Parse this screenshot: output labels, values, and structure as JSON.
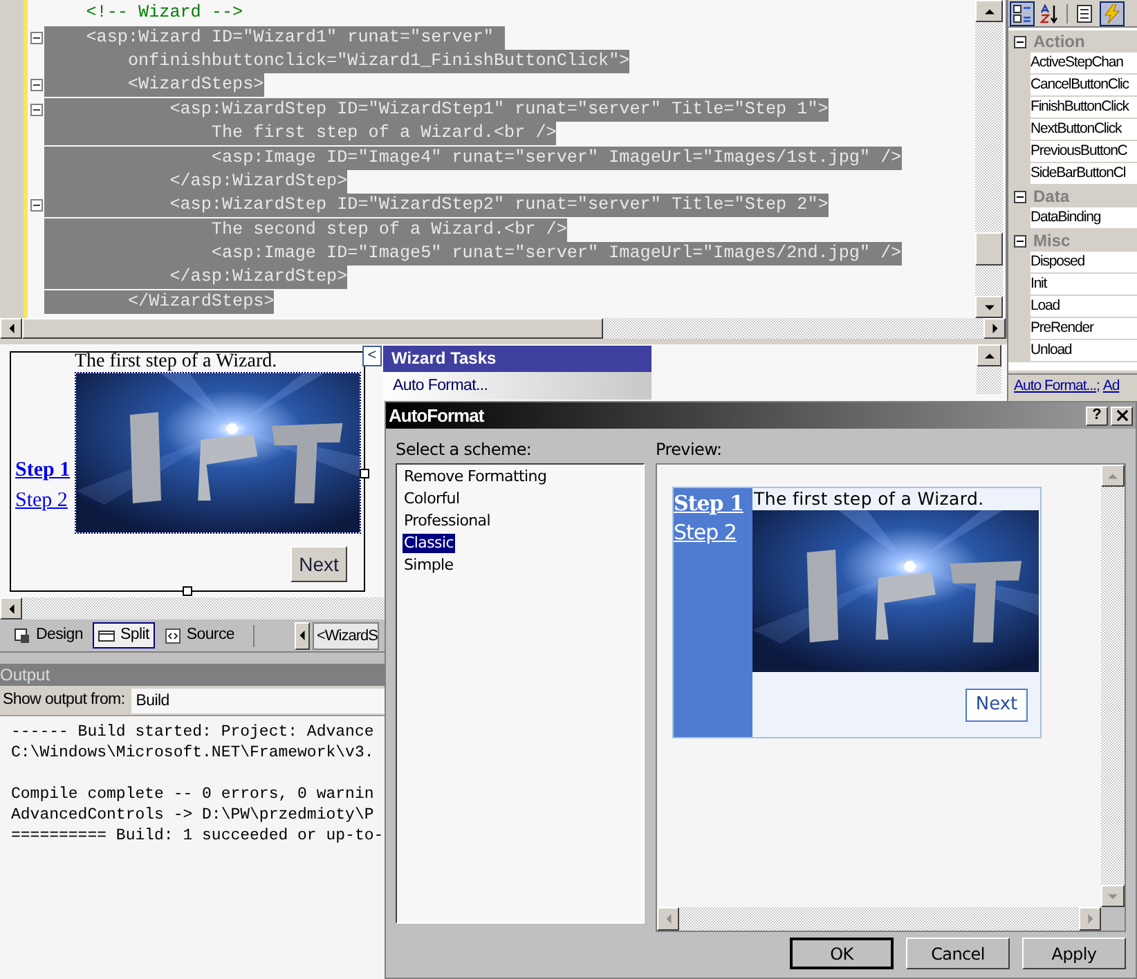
{
  "editor": {
    "lines": [
      {
        "text": "    <!-- Wizard -->",
        "kind": "comment",
        "selected": false,
        "foldable": false
      },
      {
        "text": "    <asp:Wizard ID=\"Wizard1\" runat=\"server\" ",
        "kind": "markup",
        "selected": true,
        "foldable": true
      },
      {
        "text": "        onfinishbuttonclick=\"Wizard1_FinishButtonClick\">",
        "kind": "markup",
        "selected": true,
        "foldable": false
      },
      {
        "text": "        <WizardSteps>",
        "kind": "markup",
        "selected": true,
        "foldable": true
      },
      {
        "text": "            <asp:WizardStep ID=\"WizardStep1\" runat=\"server\" Title=\"Step 1\">",
        "kind": "markup",
        "selected": true,
        "foldable": true
      },
      {
        "text": "                The first step of a Wizard.<br />",
        "kind": "markup",
        "selected": true,
        "foldable": false
      },
      {
        "text": "                <asp:Image ID=\"Image4\" runat=\"server\" ImageUrl=\"Images/1st.jpg\" />",
        "kind": "markup",
        "selected": true,
        "foldable": false
      },
      {
        "text": "            </asp:WizardStep>",
        "kind": "markup",
        "selected": true,
        "foldable": false
      },
      {
        "text": "            <asp:WizardStep ID=\"WizardStep2\" runat=\"server\" Title=\"Step 2\">",
        "kind": "markup",
        "selected": true,
        "foldable": true
      },
      {
        "text": "                The second step of a Wizard.<br />",
        "kind": "markup",
        "selected": true,
        "foldable": false
      },
      {
        "text": "                <asp:Image ID=\"Image5\" runat=\"server\" ImageUrl=\"Images/2nd.jpg\" />",
        "kind": "markup",
        "selected": true,
        "foldable": false
      },
      {
        "text": "            </asp:WizardStep>",
        "kind": "markup",
        "selected": true,
        "foldable": false
      },
      {
        "text": "        </WizardSteps>",
        "kind": "markup",
        "selected": true,
        "foldable": false
      }
    ]
  },
  "properties": {
    "toolbar": [
      {
        "kind": "categorized",
        "selected": true
      },
      {
        "kind": "alphabetical",
        "selected": false
      },
      {
        "kind": "property-pages",
        "selected": false
      },
      {
        "kind": "events",
        "selected": true
      }
    ],
    "categories": [
      {
        "name": "Action",
        "expanded": true,
        "items": [
          "ActiveStepChan",
          "CancelButtonClic",
          "FinishButtonClick",
          "NextButtonClick",
          "PreviousButtonC",
          "SideBarButtonCl"
        ]
      },
      {
        "name": "Data",
        "expanded": true,
        "items": [
          "DataBinding"
        ]
      },
      {
        "name": "Misc",
        "expanded": true,
        "items": [
          "Disposed",
          "Init",
          "Load",
          "PreRender",
          "Unload"
        ]
      }
    ],
    "verbs": [
      "Auto Format...",
      "Ad"
    ],
    "verb_separator": ";"
  },
  "design": {
    "wizard": {
      "steps": [
        {
          "label": "Step 1",
          "selected": true
        },
        {
          "label": "Step 2",
          "selected": false
        }
      ],
      "text": "The first step of a Wizard.",
      "next_button": "Next"
    },
    "smart_tag": "<",
    "tasks": {
      "title": "Wizard Tasks",
      "items": [
        "Auto Format..."
      ]
    }
  },
  "view_tabs": [
    {
      "label": "Design",
      "kind": "design",
      "selected": false
    },
    {
      "label": "Split",
      "kind": "split",
      "selected": true
    },
    {
      "label": "Source",
      "kind": "source",
      "selected": false
    }
  ],
  "breadcrumb": "<WizardS",
  "output": {
    "title": "Output",
    "show_from_label": "Show output from:",
    "show_from_value": "Build",
    "blocks": [
      [
        "------ Build started: Project: Advance",
        "C:\\Windows\\Microsoft.NET\\Framework\\v3."
      ],
      [
        "Compile complete -- 0 errors, 0 warnin",
        "AdvancedControls -> D:\\PW\\przedmioty\\P",
        "========== Build: 1 succeeded or up-to-"
      ]
    ]
  },
  "dialog": {
    "title": "AutoFormat",
    "help_button": "?",
    "scheme_label": "Select a scheme:",
    "schemes": [
      {
        "label": "Remove Formatting",
        "selected": false
      },
      {
        "label": "Colorful",
        "selected": false
      },
      {
        "label": "Professional",
        "selected": false
      },
      {
        "label": "Classic",
        "selected": true
      },
      {
        "label": "Simple",
        "selected": false
      }
    ],
    "preview_label": "Preview:",
    "preview": {
      "steps": [
        {
          "label": "Step 1",
          "selected": true
        },
        {
          "label": "Step 2",
          "selected": false
        }
      ],
      "text": "The first step of a Wizard.",
      "next_button": "Next"
    },
    "buttons": [
      "OK",
      "Cancel",
      "Apply"
    ]
  }
}
